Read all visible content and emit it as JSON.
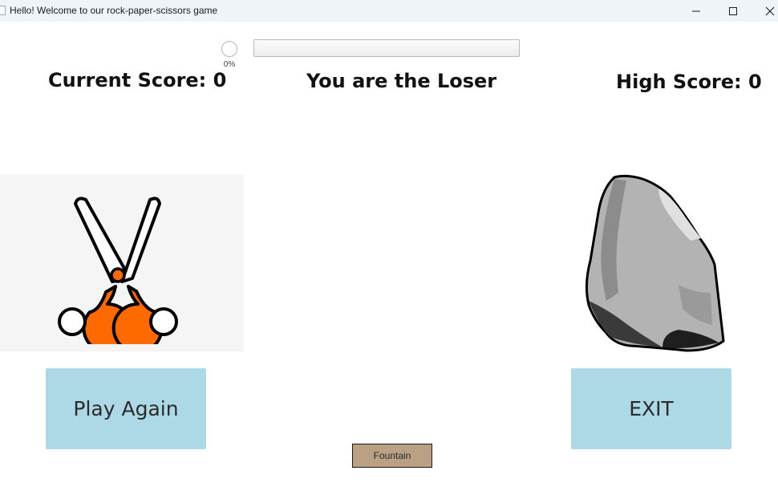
{
  "window": {
    "title": "Hello! Welcome to our rock-paper-scissors game",
    "controls": [
      "minimize-icon",
      "maximize-icon",
      "close-icon"
    ]
  },
  "progress": {
    "percent_label": "0%",
    "value": 0
  },
  "header": {
    "current_score": "Current Score: 0",
    "result": "You are the Loser",
    "high_score": "High Score: 0"
  },
  "player_choice": {
    "icon": "scissors-icon"
  },
  "computer_choice": {
    "icon": "rock-icon"
  },
  "buttons": {
    "play_again": "Play Again",
    "exit": "EXIT",
    "fountain": "Fountain"
  },
  "colors": {
    "button_bg": "#add8e6",
    "fountain_bg": "#bba184",
    "scissors_handle": "#ff6a00"
  }
}
